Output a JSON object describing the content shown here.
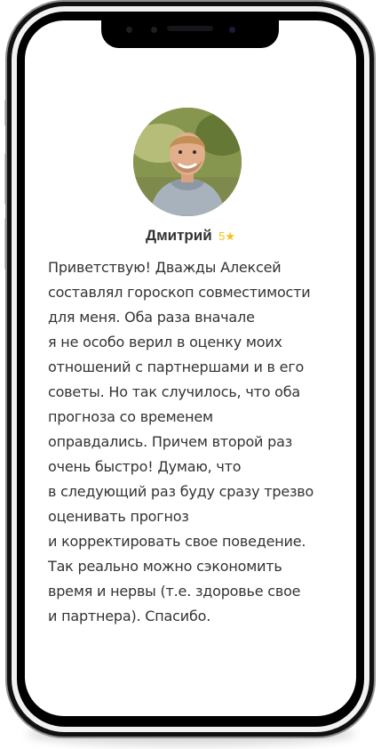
{
  "reviewer": {
    "name": "Дмитрий",
    "rating": "5",
    "star_icon": "star-icon",
    "avatar_icon": "user-photo"
  },
  "review_lines": [
    "Приветствую! Дважды Алексей",
    "составлял гороскоп совместимости",
    "для меня. Оба раза вначале",
    "я не особо верил в оценку моих",
    "отношений с партнершами и в его",
    "советы. Но так случилось, что оба",
    "прогноза со временем",
    "оправдались. Причем второй раз",
    "очень быстро! Думаю, что",
    "в следующий раз буду сразу трезво",
    "оценивать прогноз",
    "и корректировать свое поведение.",
    "Так реально можно сэкономить",
    "время и нервы (т.е. здоровье свое",
    "и партнера). Спасибо."
  ],
  "colors": {
    "star": "#f2c21a",
    "text": "#333333"
  }
}
